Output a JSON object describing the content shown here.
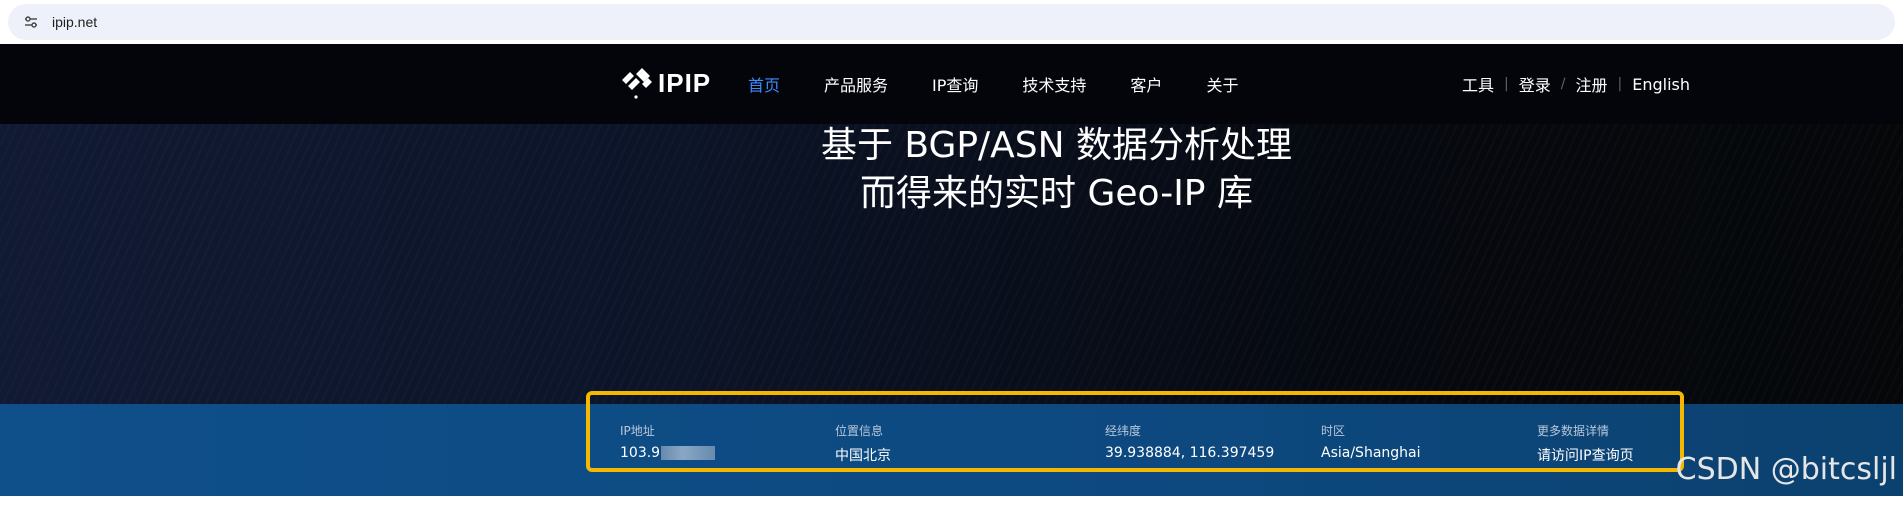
{
  "browser": {
    "url": "ipip.net"
  },
  "nav": {
    "logo_text": "IPIP",
    "menu": [
      {
        "label": "首页",
        "active": true
      },
      {
        "label": "产品服务"
      },
      {
        "label": "IP查询"
      },
      {
        "label": "技术支持"
      },
      {
        "label": "客户"
      },
      {
        "label": "关于"
      }
    ],
    "right_links": [
      {
        "label": "工具"
      },
      {
        "label": "登录"
      },
      {
        "label": "注册"
      },
      {
        "label": "English"
      }
    ]
  },
  "hero": {
    "line1": "基于 BGP/ASN 数据分析处理",
    "line2": "而得来的实时 Geo-IP 库"
  },
  "info": {
    "ip": {
      "label": "IP地址",
      "value": "103.9"
    },
    "location": {
      "label": "位置信息",
      "value": "中国北京"
    },
    "coords": {
      "label": "经纬度",
      "value": "39.938884, 116.397459"
    },
    "timezone": {
      "label": "时区",
      "value": "Asia/Shanghai"
    },
    "more": {
      "label": "更多数据详情",
      "value": "请访问IP查询页"
    }
  },
  "watermark": "CSDN @bitcsljl",
  "colors": {
    "accent": "#3d8bfd",
    "highlight_border": "#f5b800",
    "strip": "#0f4f8a"
  }
}
